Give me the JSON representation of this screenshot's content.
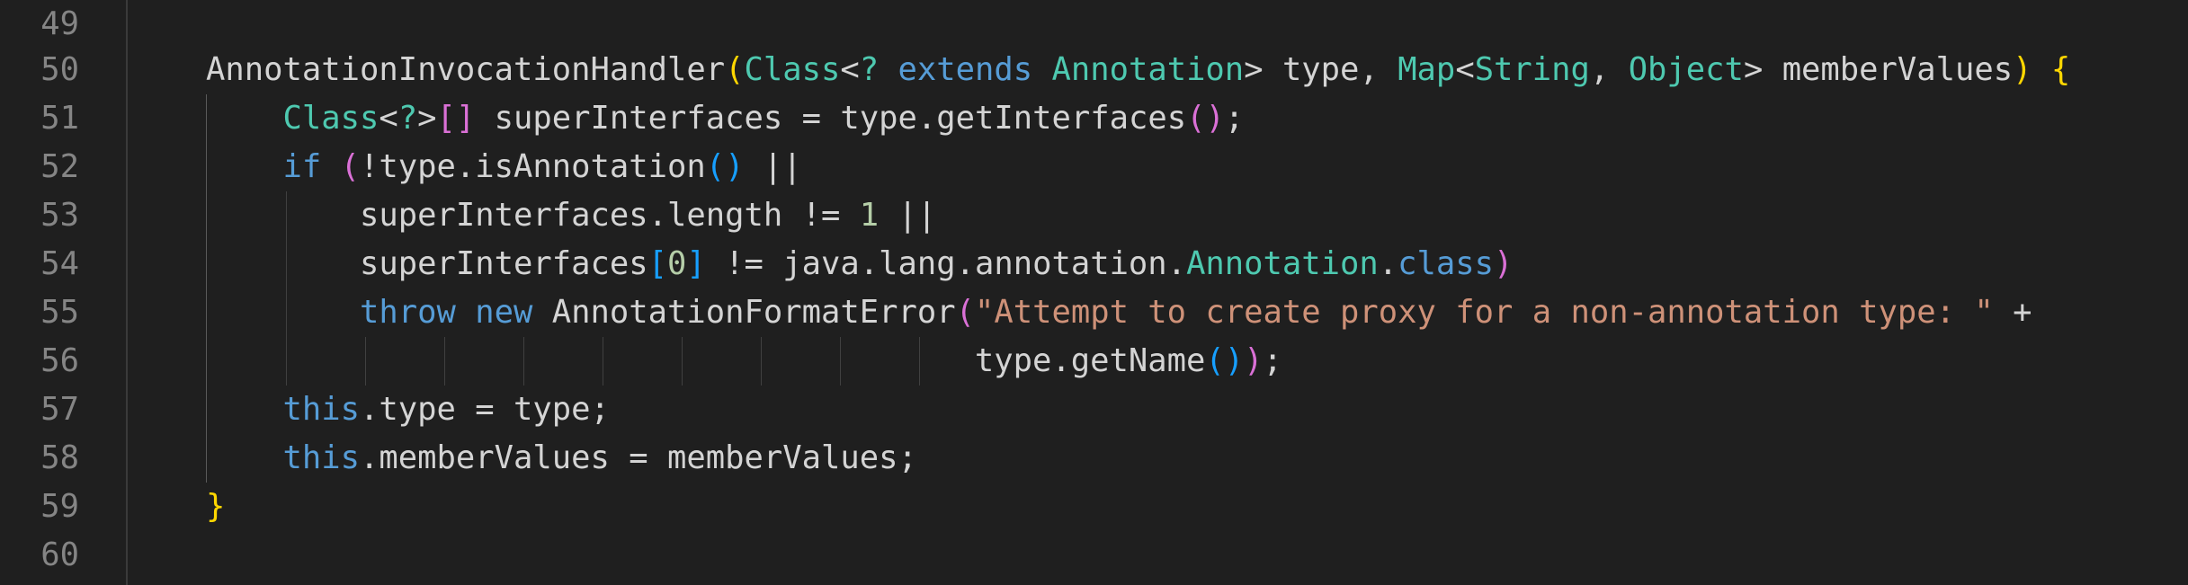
{
  "editor": {
    "language": "java",
    "colors": {
      "background": "#1f1f1f",
      "line_number": "#858585",
      "keyword": "#569cd6",
      "type": "#569cd6",
      "string": "#ce9178",
      "number": "#b5cea8",
      "default_text": "#d4d4d4",
      "bracket_gold": "#ffd700",
      "bracket_orchid": "#da70d6",
      "bracket_blue": "#179fff"
    },
    "line_numbers": [
      "49",
      "50",
      "51",
      "52",
      "53",
      "54",
      "55",
      "56",
      "57",
      "58",
      "59",
      "60"
    ],
    "lines": [
      "",
      "    AnnotationInvocationHandler(Class<? extends Annotation> type, Map<String, Object> memberValues) {",
      "        Class<?>[] superInterfaces = type.getInterfaces();",
      "        if (!type.isAnnotation() ||",
      "            superInterfaces.length != 1 ||",
      "            superInterfaces[0] != java.lang.annotation.Annotation.class)",
      "            throw new AnnotationFormatError(\"Attempt to create proxy for a non-annotation type: \" +",
      "                                            type.getName());",
      "        this.type = type;",
      "        this.memberValues = memberValues;",
      "    }",
      ""
    ]
  }
}
